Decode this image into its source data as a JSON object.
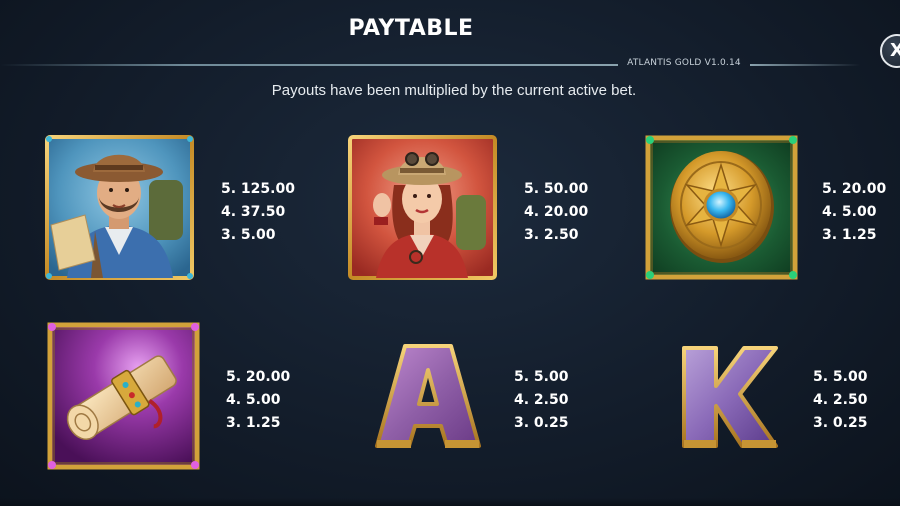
{
  "header": {
    "title": "PAYTABLE",
    "version": "ATLANTIS GOLD V1.0.14",
    "close_label": "X"
  },
  "subtitle": "Payouts have been multiplied by the current active bet.",
  "symbols": [
    {
      "icon": "explorer-man-icon",
      "payouts": [
        "5. 125.00",
        "4. 37.50",
        "3. 5.00"
      ]
    },
    {
      "icon": "explorer-woman-icon",
      "payouts": [
        "5. 50.00",
        "4. 20.00",
        "3. 2.50"
      ]
    },
    {
      "icon": "golden-medallion-icon",
      "payouts": [
        "5. 20.00",
        "4. 5.00",
        "3. 1.25"
      ]
    },
    {
      "icon": "scroll-map-icon",
      "payouts": [
        "5. 20.00",
        "4. 5.00",
        "3. 1.25"
      ]
    },
    {
      "icon": "letter-a-icon",
      "glyph": "A",
      "payouts": [
        "5. 5.00",
        "4. 2.50",
        "3. 0.25"
      ]
    },
    {
      "icon": "letter-k-icon",
      "glyph": "K",
      "payouts": [
        "5. 5.00",
        "4. 2.50",
        "3. 0.25"
      ]
    }
  ],
  "colors": {
    "background": "#131d2b",
    "frame_gold": "#d7a93c",
    "card_blue": "#3d7ea8",
    "card_red": "#c23a30",
    "card_green": "#1f6b3a",
    "card_purple": "#7a2a8c",
    "letter_purple": "#9a6aa8"
  }
}
